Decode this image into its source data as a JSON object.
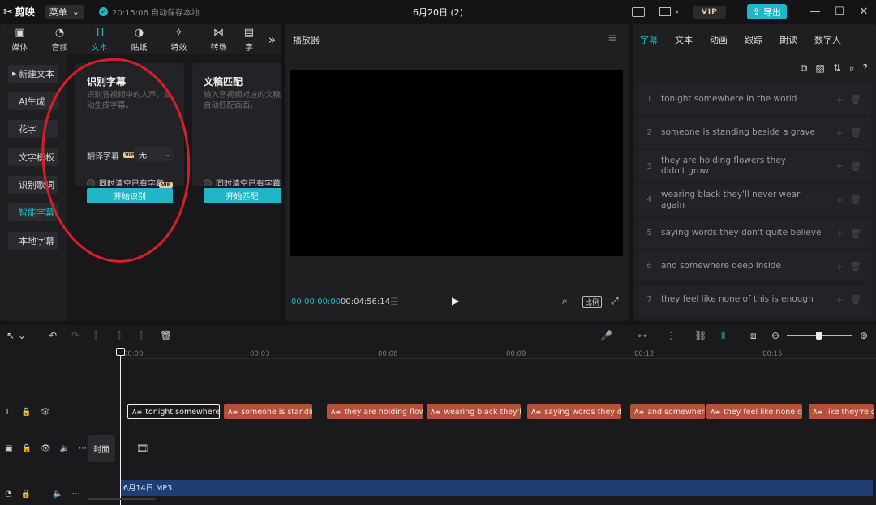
{
  "app": {
    "logo_text": "剪映",
    "menu_label": "菜单",
    "autosave_text": "20:15:06 自动保存本地",
    "document_title": "6月20日 (2)",
    "vip_label": "VIP",
    "export_label": "导出"
  },
  "material_tabs": [
    {
      "label": "媒体",
      "icon": "media-icon"
    },
    {
      "label": "音频",
      "icon": "audio-icon"
    },
    {
      "label": "文本",
      "icon": "text-icon"
    },
    {
      "label": "贴纸",
      "icon": "sticker-icon"
    },
    {
      "label": "特效",
      "icon": "effects-icon"
    },
    {
      "label": "转场",
      "icon": "transition-icon"
    },
    {
      "label": "字",
      "icon": "caption-icon"
    }
  ],
  "text_nav": [
    {
      "label": "新建文本"
    },
    {
      "label": "AI生成"
    },
    {
      "label": "花字"
    },
    {
      "label": "文字模板"
    },
    {
      "label": "识别歌词"
    },
    {
      "label": "智能字幕"
    },
    {
      "label": "本地字幕"
    }
  ],
  "cards": {
    "recognize": {
      "title": "识别字幕",
      "desc": "识别音视频中的人声，自动生成字幕。",
      "translate_label": "翻译字幕",
      "translate_value": "无",
      "clear_label": "同时清空已有字幕",
      "action_label": "开始识别",
      "vip_tag": "VIP"
    },
    "match": {
      "title": "文稿匹配",
      "desc": "输入音视频对应的文稿，自动匹配画面。",
      "clear_label": "同时清空已有字幕",
      "action_label": "开始匹配"
    }
  },
  "player": {
    "title": "播放器",
    "current_time": "00:00:00:00",
    "duration": "00:04:56:14",
    "ratio_label": "比例"
  },
  "right_panel": {
    "tabs": [
      "字幕",
      "文本",
      "动画",
      "跟踪",
      "朗读",
      "数字人"
    ],
    "subtitles": [
      {
        "num": "1",
        "text": "tonight somewhere in the world"
      },
      {
        "num": "2",
        "text": "someone is standing beside a grave"
      },
      {
        "num": "3",
        "text": "they are holding flowers they didn't grow"
      },
      {
        "num": "4",
        "text": "wearing black they'll never wear again"
      },
      {
        "num": "5",
        "text": "saying words they don't quite believe"
      },
      {
        "num": "6",
        "text": "and somewhere deep inside"
      },
      {
        "num": "7",
        "text": "they feel like none of this is enough"
      }
    ]
  },
  "timeline": {
    "ticks": [
      "00:00",
      "00:03",
      "00:06",
      "00:09",
      "00:12",
      "00:15"
    ],
    "cover_label": "封面",
    "audio_clip_label": "6月14日.MP3",
    "subtitle_clips": [
      {
        "text": "tonight somewhere in"
      },
      {
        "text": "someone is standing b"
      },
      {
        "text": "they are holding flowers"
      },
      {
        "text": "wearing black they'll ne"
      },
      {
        "text": "saying words they don't"
      },
      {
        "text": "and somewhere d"
      },
      {
        "text": "they feel like none of thi"
      },
      {
        "text": "like they're doi"
      }
    ]
  },
  "colors": {
    "accent": "#1fb6c8",
    "subtitle_clip": "#b5503b",
    "audio_clip": "#1f3f74",
    "annotation_circle": "#d81e2a"
  }
}
